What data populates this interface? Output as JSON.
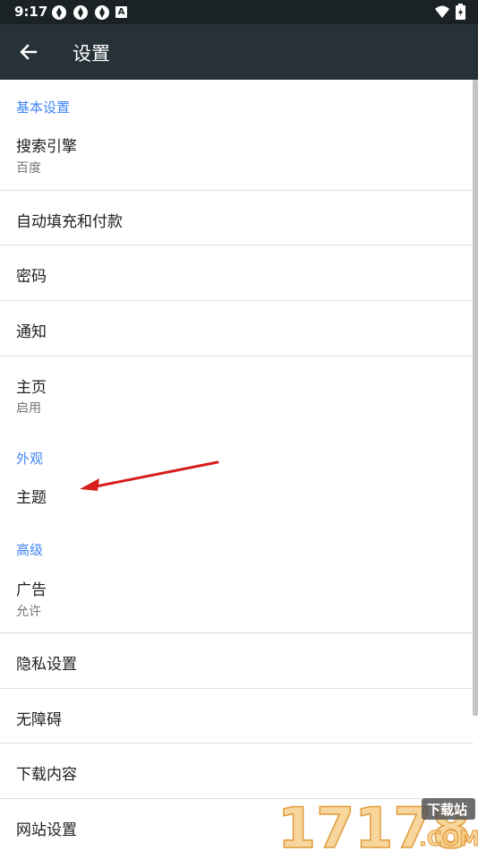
{
  "status_bar": {
    "time": "9:17",
    "notification_icons": [
      "cast-icon",
      "cast-icon",
      "cast-icon",
      "a-icon"
    ],
    "a_badge": "A",
    "right_icons": [
      "wifi-icon",
      "battery-icon"
    ]
  },
  "toolbar": {
    "title": "设置",
    "back_icon": "arrow-left-icon",
    "background": "#263238"
  },
  "accent_color": "#4285f4",
  "sections": {
    "basic": {
      "header": "基本设置",
      "search_engine": {
        "title": "搜索引擎",
        "summary": "百度"
      },
      "autofill": {
        "title": "自动填充和付款"
      },
      "passwords": {
        "title": "密码"
      },
      "notifications": {
        "title": "通知"
      },
      "homepage": {
        "title": "主页",
        "summary": "启用"
      }
    },
    "appearance": {
      "header": "外观",
      "theme": {
        "title": "主题"
      }
    },
    "advanced": {
      "header": "高级",
      "ads": {
        "title": "广告",
        "summary": "允许"
      },
      "privacy": {
        "title": "隐私设置"
      },
      "accessibility": {
        "title": "无障碍"
      },
      "downloads": {
        "title": "下载内容"
      },
      "site_settings": {
        "title": "网站设置"
      }
    }
  },
  "watermark": {
    "number": "17178",
    "badge": "下载站",
    "domain": ".COM"
  }
}
